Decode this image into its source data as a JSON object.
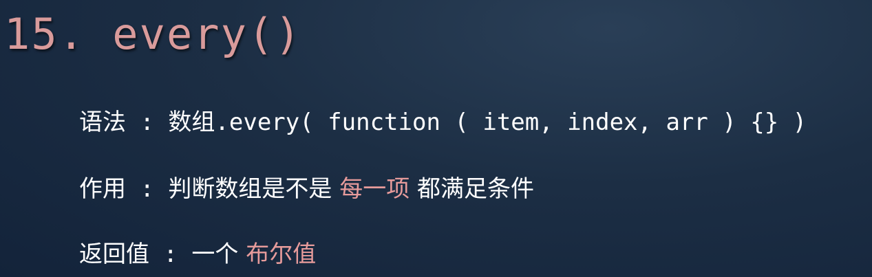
{
  "title": "15. every()",
  "syntax": {
    "label": "语法",
    "separator": " : ",
    "object": "数组",
    "code": ".every( function ( item, index, arr ) {} )"
  },
  "purpose": {
    "label": "作用",
    "separator": " : ",
    "text_before": "判断数组是不是 ",
    "highlight": "每一项",
    "text_after": " 都满足条件"
  },
  "return_value": {
    "label": "返回值",
    "separator": " : ",
    "text_before": "一个 ",
    "highlight": "布尔值"
  },
  "colors": {
    "background": "#1c2e44",
    "title": "#d99b9b",
    "highlight": "#e79b9b",
    "text": "#ffffff"
  }
}
